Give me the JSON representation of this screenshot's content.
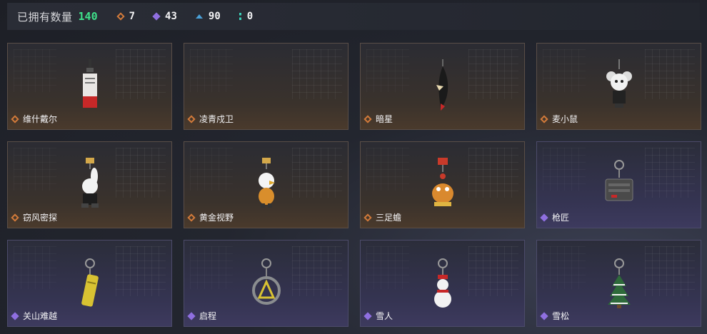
{
  "header": {
    "owned_label": "已拥有数量",
    "owned_count": "140",
    "stats": [
      {
        "icon": "orange-diamond-icon",
        "value": "7"
      },
      {
        "icon": "purple-diamond-icon",
        "value": "43"
      },
      {
        "icon": "blue-triangle-icon",
        "value": "90"
      },
      {
        "icon": "teal-dots-icon",
        "value": "0"
      }
    ]
  },
  "colors": {
    "accent_green": "#3fe08a",
    "rarity_orange": "#d27a3a",
    "rarity_purple": "#8f6fe0",
    "rarity_blue": "#4aa0d8"
  },
  "items": [
    {
      "name": "维什戴尔",
      "rarity": "orange",
      "charm": "tag-charm"
    },
    {
      "name": "凌青戍卫",
      "rarity": "orange",
      "charm": "none"
    },
    {
      "name": "暗星",
      "rarity": "orange",
      "charm": "feather-charm"
    },
    {
      "name": "麦小鼠",
      "rarity": "orange",
      "charm": "mouse-charm"
    },
    {
      "name": "窃风密探",
      "rarity": "orange",
      "charm": "bunny-charm"
    },
    {
      "name": "黄金视野",
      "rarity": "orange",
      "charm": "eagle-charm"
    },
    {
      "name": "三足蟾",
      "rarity": "orange",
      "charm": "toad-charm"
    },
    {
      "name": "枪匠",
      "rarity": "purple",
      "charm": "gun-charm"
    },
    {
      "name": "关山难越",
      "rarity": "purple",
      "charm": "tube-charm"
    },
    {
      "name": "启程",
      "rarity": "purple",
      "charm": "ring-charm"
    },
    {
      "name": "雪人",
      "rarity": "purple",
      "charm": "snowman-charm"
    },
    {
      "name": "雪松",
      "rarity": "purple",
      "charm": "tree-charm"
    }
  ]
}
